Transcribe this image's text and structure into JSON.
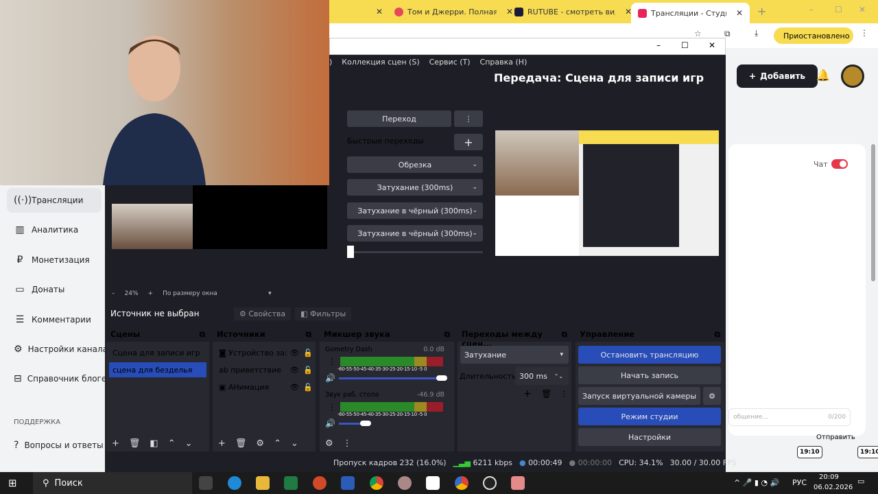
{
  "browser": {
    "tabs": [
      {
        "label": "Том и Джерри. Полная к",
        "favicon": "#e8465a"
      },
      {
        "label": "RUTUBE - смотреть видео",
        "favicon": "#1a1a3a"
      },
      {
        "label": "Трансляции - Студия RUT",
        "favicon": "#e8245a",
        "active": true
      }
    ],
    "profile_status": "Приостановлено",
    "accent": "#f7dc52"
  },
  "sidebar": {
    "items": [
      {
        "label": "Трансляции",
        "icon": "broadcast-icon",
        "active": true
      },
      {
        "label": "Аналитика",
        "icon": "analytics-icon"
      },
      {
        "label": "Монетизация",
        "icon": "ruble-icon"
      },
      {
        "label": "Донаты",
        "icon": "wallet-icon"
      },
      {
        "label": "Комментарии",
        "icon": "comment-icon"
      },
      {
        "label": "Настройки канала",
        "icon": "gear-icon"
      },
      {
        "label": "Справочник блогера",
        "icon": "book-icon"
      }
    ],
    "support_heading": "ПОДДЕРЖКА",
    "faq": "Вопросы и ответы"
  },
  "studio": {
    "add_button": "Добавить",
    "chat_label": "Чат",
    "message_placeholder": "общение...",
    "char_count": "0/200",
    "send": "Отправить",
    "clock_left": "19:10",
    "clock_right": "19:10"
  },
  "obs": {
    "menu": [
      ")",
      "Коллекция сцен (S)",
      "Сервис (T)",
      "Справка (H)"
    ],
    "program_title": "Передача: Сцена для записи игр",
    "transition_button": "Переход",
    "quick_transitions": "Быстрые переходы",
    "quick": [
      "Обрезка",
      "Затухание (300ms)",
      "Затухание в чёрный (300ms)",
      "Затухание в чёрный (300ms)"
    ],
    "zoom": "24%",
    "fit": "По размеру окна",
    "no_source": "Источник не выбран",
    "properties": "Свойства",
    "filters": "Фильтры",
    "scenes": {
      "title": "Сцены",
      "items": [
        {
          "label": "Сцена для записи игр"
        },
        {
          "label": "сцена для безделья",
          "selected": true
        }
      ]
    },
    "sources": {
      "title": "Источники",
      "items": [
        {
          "label": "Устройство за:",
          "icon": "camera-icon"
        },
        {
          "label": "приветствие",
          "icon": "text-icon"
        },
        {
          "label": "АНимация",
          "icon": "image-icon"
        }
      ]
    },
    "mixer": {
      "title": "Микшер звука",
      "ticks": "-60-55-50-45-40-35-30-25-20-15-10 -5  0",
      "channels": [
        {
          "name": "Gometry Dash",
          "db": "0.0 dB",
          "volume": 1.0
        },
        {
          "name": "Звук раб. стола",
          "db": "-46.9 dB",
          "volume": 0.26
        }
      ]
    },
    "transitions": {
      "title": "Переходы между сцен...",
      "selected": "Затухание",
      "duration_label": "Длительность",
      "duration": "300 ms"
    },
    "controls": {
      "title": "Управление",
      "stop_stream": "Остановить трансляцию",
      "start_record": "Начать запись",
      "virtual_cam": "Запуск виртуальной камеры",
      "studio_mode": "Режим студии",
      "settings": "Настройки"
    },
    "status": {
      "dropped": "Пропуск кадров 232 (16.0%)",
      "bitrate": "6211 kbps",
      "stream_time": "00:00:49",
      "record_time": "00:00:00",
      "cpu": "CPU: 34.1%",
      "fps": "30.00 / 30.00 FPS"
    }
  },
  "taskbar": {
    "search": "Поиск",
    "lang": "РУС",
    "time": "20:09",
    "date": "06.02.2026"
  }
}
